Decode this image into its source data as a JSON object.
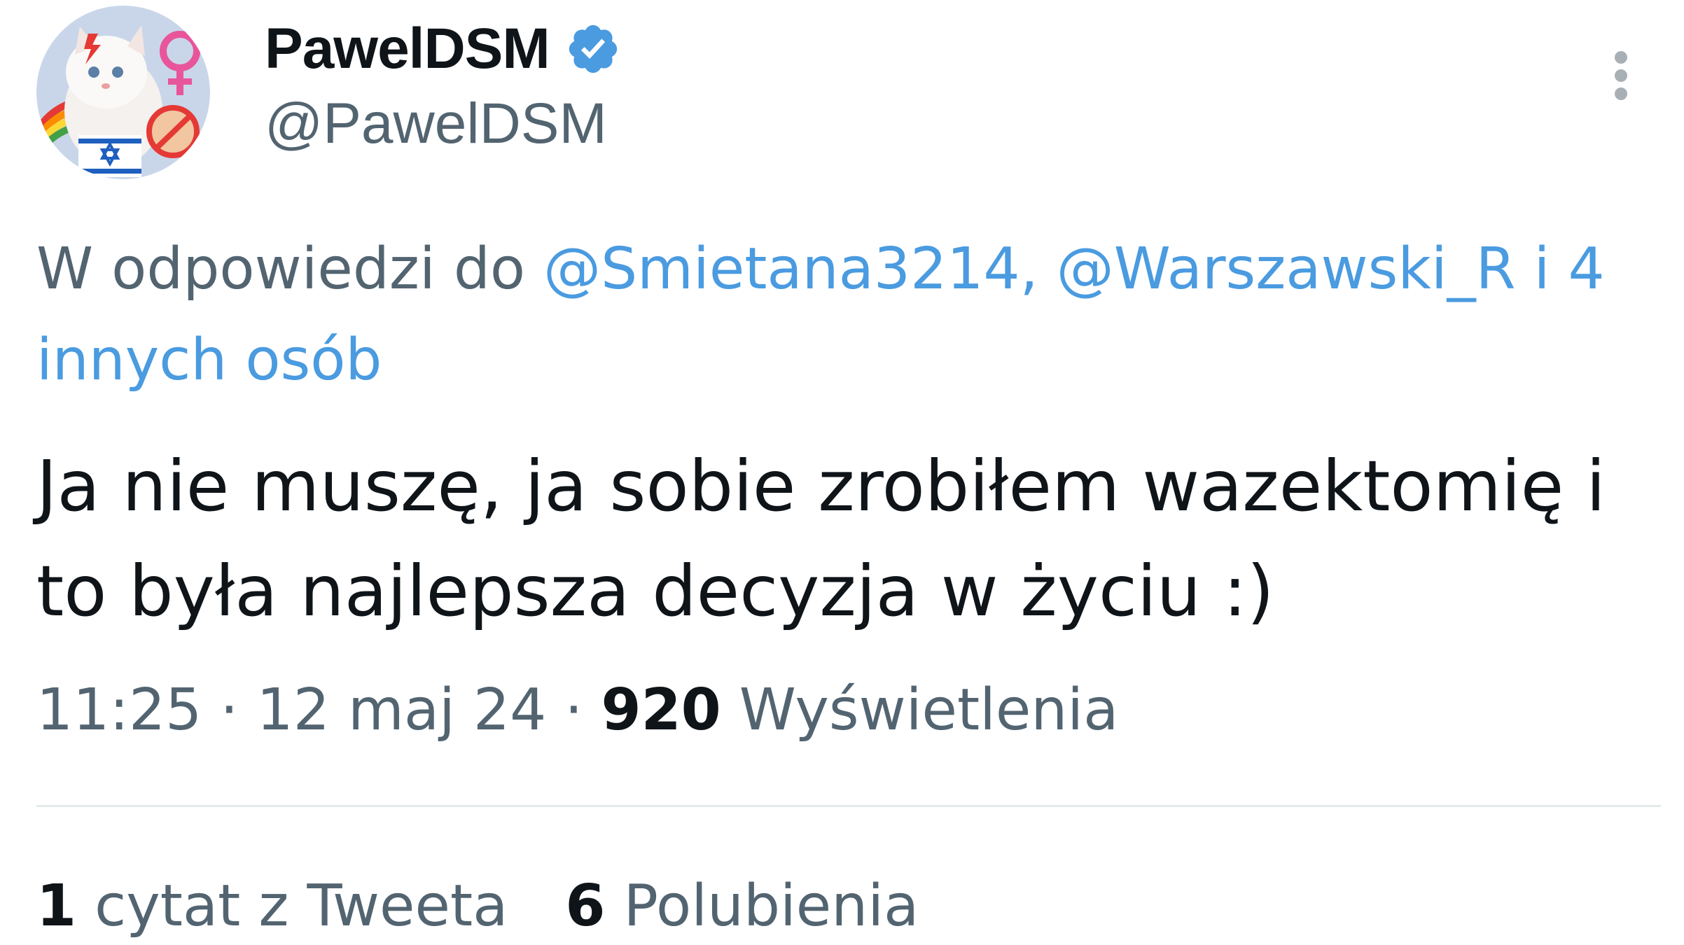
{
  "author": {
    "display_name": "PawelDSM",
    "handle": "@PawelDSM",
    "verified_icon": "verified-badge-icon",
    "verified_color": "#4a9be0"
  },
  "reply": {
    "prefix": "W odpowiedzi do",
    "mentions": [
      "@Smietana3214,",
      "@Warszawski_R"
    ],
    "others": "i 4 innych osób"
  },
  "tweet": {
    "text": "Ja nie muszę, ja sobie zrobiłem wazektomię i to była najlepsza decyzja w życiu :)"
  },
  "meta": {
    "time": "11:25",
    "separator": "·",
    "date": "12 maj 24",
    "views_count": "920",
    "views_label": "Wyświetlenia"
  },
  "stats": {
    "quotes_count": "1",
    "quotes_label": "cytat z Tweeta",
    "likes_count": "6",
    "likes_label": "Polubienia"
  },
  "colors": {
    "text_primary": "#0f1419",
    "text_secondary": "#536471",
    "link": "#4a9be0",
    "divider": "#e6e9ec"
  },
  "icons": {
    "more": "more-options-icon"
  }
}
